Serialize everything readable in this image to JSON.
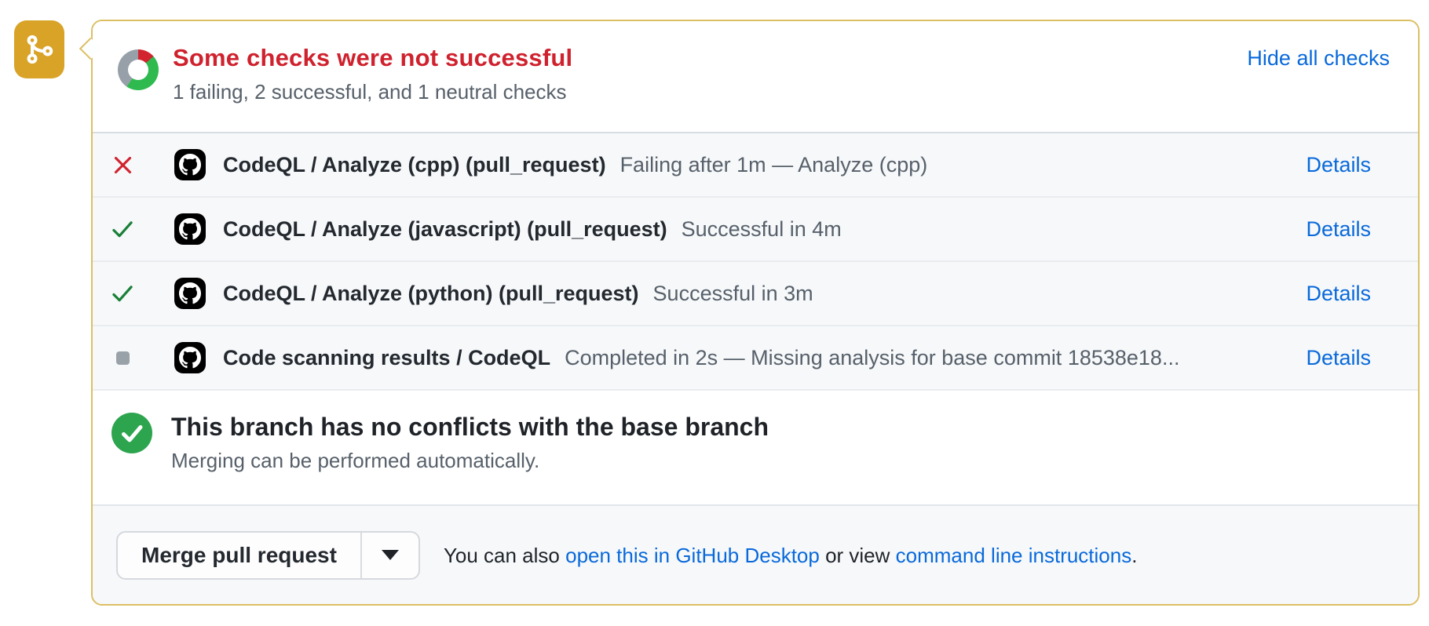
{
  "colors": {
    "attention_border": "#dcbf63",
    "attention_icon_bg": "#d8a327",
    "danger": "#cf222e",
    "donut_danger": "#d1242f",
    "donut_success": "#2fba50",
    "donut_neutral": "#97a0a8",
    "success_emphasis": "#2da44e",
    "check_success": "#1a7f37",
    "neutral_gray": "#99a1a9",
    "link": "#0969da"
  },
  "icons": {
    "timeline": "git-merge-icon",
    "failing": "x-icon",
    "success": "check-icon",
    "neutral": "square-fill-icon",
    "avatar": "github-octocat-icon",
    "dropdown": "caret-down-icon",
    "no_conflicts": "check-circle-icon"
  },
  "header": {
    "title": "Some checks were not successful",
    "summary": "1 failing, 2 successful, and 1 neutral checks",
    "hide_link": "Hide all checks",
    "donut": {
      "failing_pct": 13.5,
      "success_pct": 46,
      "neutral_pct": 40.5
    }
  },
  "checks": [
    {
      "status": "failing",
      "name": "CodeQL / Analyze (cpp) (pull_request)",
      "description": "Failing after 1m — Analyze (cpp)",
      "details_label": "Details"
    },
    {
      "status": "success",
      "name": "CodeQL / Analyze (javascript) (pull_request)",
      "description": "Successful in 4m",
      "details_label": "Details"
    },
    {
      "status": "success",
      "name": "CodeQL / Analyze (python) (pull_request)",
      "description": "Successful in 3m",
      "details_label": "Details"
    },
    {
      "status": "neutral",
      "name": "Code scanning results / CodeQL",
      "description": "Completed in 2s — Missing analysis for base commit 18538e18...",
      "details_label": "Details"
    }
  ],
  "merge_status": {
    "title": "This branch has no conflicts with the base branch",
    "subtitle": "Merging can be performed automatically."
  },
  "merge_actions": {
    "merge_button_label": "Merge pull request",
    "alt_prefix": "You can also ",
    "desktop_link": "open this in GitHub Desktop",
    "alt_middle": " or view ",
    "cli_link": "command line instructions",
    "alt_suffix": "."
  }
}
